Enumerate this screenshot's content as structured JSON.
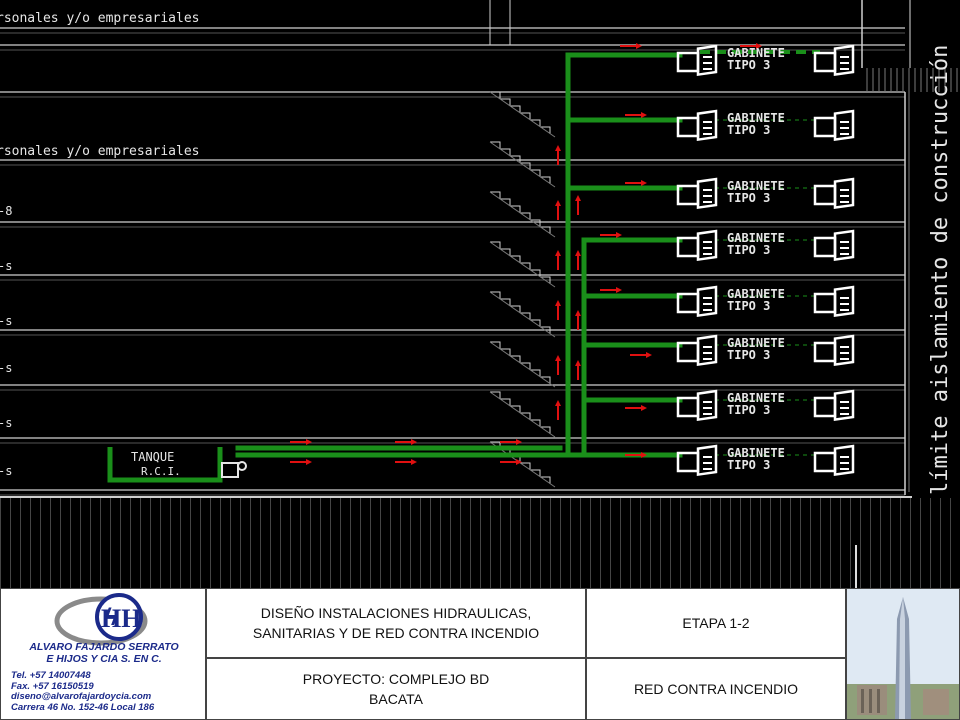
{
  "drawing": {
    "floor_labels": {
      "top_1": "rsonales y/o empresariales",
      "top_2": "rsonales y/o empresariales",
      "left_edge": [
        "-8",
        "-s",
        "-s",
        "-s",
        "-s",
        "-s"
      ]
    },
    "cabinet_label_line1": "GABINETE",
    "cabinet_label_line2": "TIPO 3",
    "tank_label_line1": "TANQUE",
    "tank_label_line2": "R.C.I.",
    "vertical_text": "límite aislamiento de construcción",
    "colors": {
      "background": "#000000",
      "pipe": "#1a8f1a",
      "arrows": "#e01010",
      "structure": "#cfcfcf",
      "text": "#e6e6e6"
    }
  },
  "title_block": {
    "company_name_1": "ALVARO FAJARDO SERRATO",
    "company_name_2": "E HIJOS Y CIA S. EN C.",
    "phone": "Tel. +57 14007448",
    "fax": "Fax. +57 16150519",
    "email": "diseno@alvarofajardoycia.com",
    "address": "Carrera 46 No. 152-46 Local 186",
    "design_title": "DISEÑO INSTALACIONES HIDRAULICAS, SANITARIAS Y DE RED CONTRA INCENDIO",
    "stage": "ETAPA 1-2",
    "project": "PROYECTO: COMPLEJO BD BACATA",
    "system": "RED CONTRA INCENDIO"
  }
}
